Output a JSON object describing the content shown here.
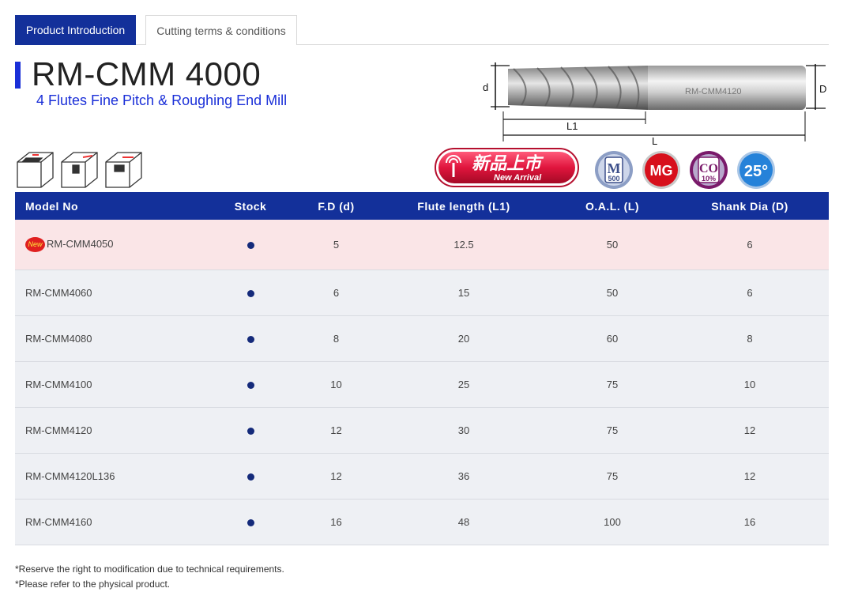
{
  "tabs": [
    {
      "label": "Product Introduction",
      "active": true
    },
    {
      "label": "Cutting terms & conditions",
      "active": false
    }
  ],
  "product": {
    "title": "RM-CMM 4000",
    "subtitle": "4 Flutes Fine Pitch & Roughing End Mill"
  },
  "diagram": {
    "label_d": "d",
    "label_D": "D",
    "label_L1": "L1",
    "label_L": "L",
    "tool_marking": "RM-CMM4120"
  },
  "badges": {
    "new_arrival_cn": "新品上市",
    "new_arrival_en": "New Arrival",
    "m_top": "M",
    "m_bottom": "500",
    "mg": "MG",
    "co_top": "CO",
    "co_bottom": "10%",
    "helix": "25°"
  },
  "table": {
    "headers": [
      "Model No",
      "Stock",
      "F.D (d)",
      "Flute length (L1)",
      "O.A.L. (L)",
      "Shank Dia (D)"
    ],
    "new_tag": "New",
    "rows": [
      {
        "model": "RM-CMM4050",
        "fd": "5",
        "flute": "12.5",
        "oal": "50",
        "shank": "6"
      },
      {
        "model": "RM-CMM4060",
        "fd": "6",
        "flute": "15",
        "oal": "50",
        "shank": "6"
      },
      {
        "model": "RM-CMM4080",
        "fd": "8",
        "flute": "20",
        "oal": "60",
        "shank": "8"
      },
      {
        "model": "RM-CMM4100",
        "fd": "10",
        "flute": "25",
        "oal": "75",
        "shank": "10"
      },
      {
        "model": "RM-CMM4120",
        "fd": "12",
        "flute": "30",
        "oal": "75",
        "shank": "12"
      },
      {
        "model": "RM-CMM4120L136",
        "fd": "12",
        "flute": "36",
        "oal": "75",
        "shank": "12"
      },
      {
        "model": "RM-CMM4160",
        "fd": "16",
        "flute": "48",
        "oal": "100",
        "shank": "16"
      }
    ]
  },
  "notes": [
    "*Reserve the right to modification due to technical requirements.",
    "*Please refer to the physical product."
  ],
  "colors": {
    "primary": "#13309a",
    "accent_blue": "#1a2fd8",
    "highlight_row": "#fae5e7",
    "row_bg": "#eef0f4"
  }
}
